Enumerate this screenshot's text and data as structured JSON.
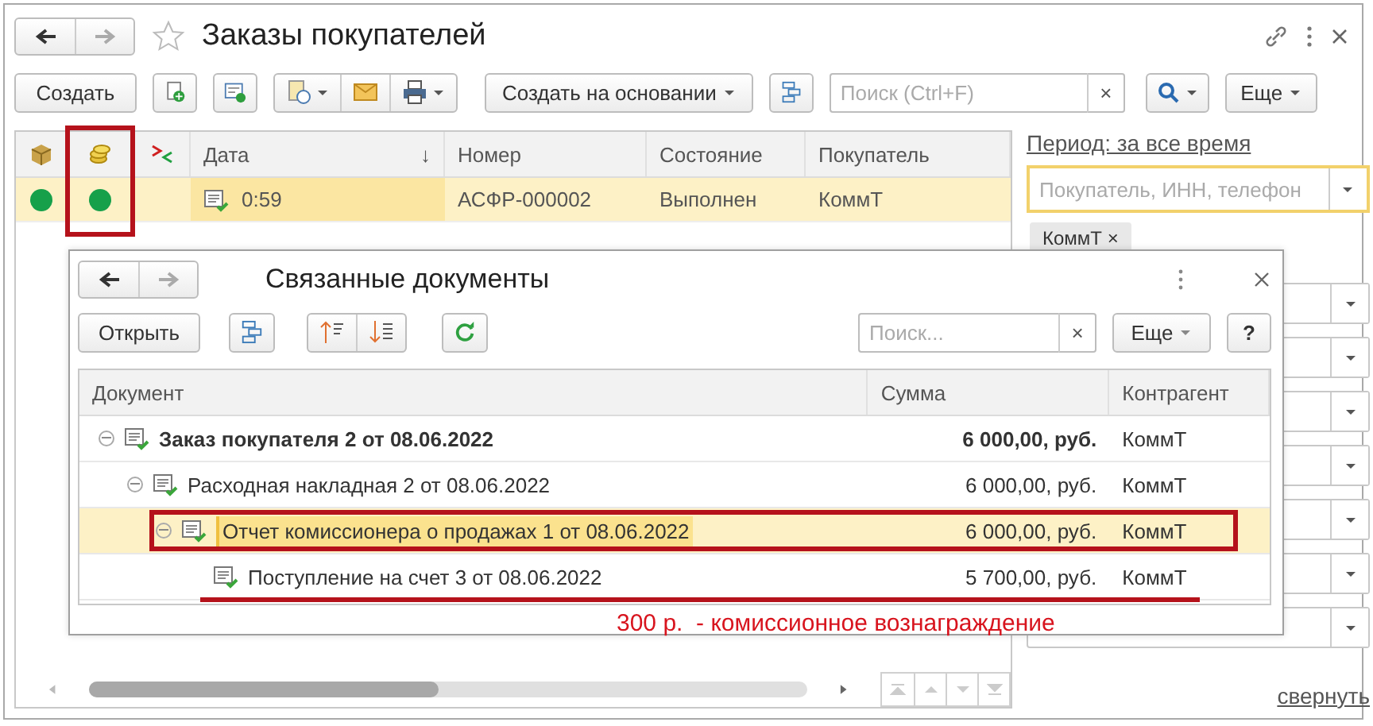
{
  "window": {
    "title": "Заказы покупателей"
  },
  "toolbar": {
    "create": "Создать",
    "create_based": "Создать на основании",
    "search_placeholder": "Поиск (Ctrl+F)",
    "clear": "×",
    "more": "Еще"
  },
  "table": {
    "columns": [
      {
        "kind": "icon",
        "highlighted": false
      },
      {
        "kind": "icon",
        "highlighted": true
      },
      {
        "kind": "icon",
        "highlighted": false
      },
      {
        "kind": "text",
        "label": "Дата",
        "sort": "↓"
      },
      {
        "kind": "text",
        "label": "Номер"
      },
      {
        "kind": "text",
        "label": "Состояние"
      },
      {
        "kind": "text",
        "label": "Покупатель"
      }
    ],
    "rows": [
      {
        "selected": true,
        "shipped": true,
        "paid": true,
        "date": "0:59",
        "number": "АСФР-000002",
        "state": "Выполнен",
        "buyer": "КоммТ"
      }
    ]
  },
  "filters": {
    "period": "Период: за все время",
    "search_placeholder": "Покупатель, ИНН, телефон",
    "chip": "КоммТ",
    "chip_remove": "×"
  },
  "collapse_link": "свернуть",
  "dialog": {
    "title": "Связанные документы",
    "open": "Открыть",
    "search_placeholder": "Поиск...",
    "clear": "×",
    "more": "Еще",
    "help": "?",
    "columns": [
      "Документ",
      "Сумма",
      "Контрагент"
    ],
    "rows": [
      {
        "document": "Заказ покупателя 2 от 08.06.2022",
        "sum": "6 000,00, руб.",
        "party": "КоммТ",
        "expanded": true,
        "selected": false,
        "children": [
          {
            "document": "Расходная накладная 2 от 08.06.2022",
            "sum": "6 000,00, руб.",
            "party": "КоммТ",
            "expanded": true,
            "selected": false,
            "children": [
              {
                "document": "Отчет комиссионера о продажах 1 от 08.06.2022",
                "sum": "6 000,00, руб.",
                "party": "КоммТ",
                "expanded": true,
                "selected": true,
                "highlighted": true,
                "children": [
                  {
                    "document": "Поступление на счет 3 от 08.06.2022",
                    "sum": "5 700,00, руб.",
                    "party": "КоммТ",
                    "selected": false,
                    "underlined": true
                  }
                ]
              }
            ]
          }
        ]
      }
    ]
  },
  "annotation": "300 р.  - комиссионное вознаграждение"
}
